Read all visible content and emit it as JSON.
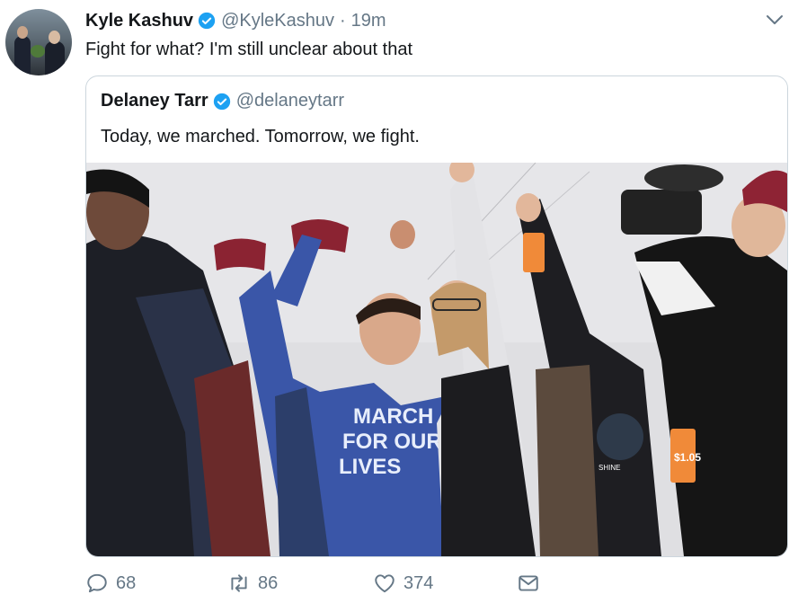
{
  "tweet": {
    "author_name": "Kyle Kashuv",
    "author_handle": "@KyleKashuv",
    "separator": "·",
    "time": "19m",
    "text": "Fight for what? I'm still unclear about that"
  },
  "quoted": {
    "author_name": "Delaney Tarr",
    "author_handle": "@delaneytarr",
    "text": "Today, we marched. Tomorrow, we fight.",
    "image_signs": {
      "hoodie": [
        "MARCH",
        "FOR OUR",
        "LIVES"
      ],
      "tag": "$1.05",
      "shirt": "SHINE"
    }
  },
  "actions": {
    "replies": "68",
    "retweets": "86",
    "likes": "374"
  },
  "colors": {
    "verified": "#1da1f2",
    "secondary_text": "#657786",
    "border": "#ccd6dd"
  },
  "icons": [
    "verified-badge-icon",
    "chevron-down-icon",
    "reply-icon",
    "retweet-icon",
    "like-icon",
    "dm-icon"
  ]
}
